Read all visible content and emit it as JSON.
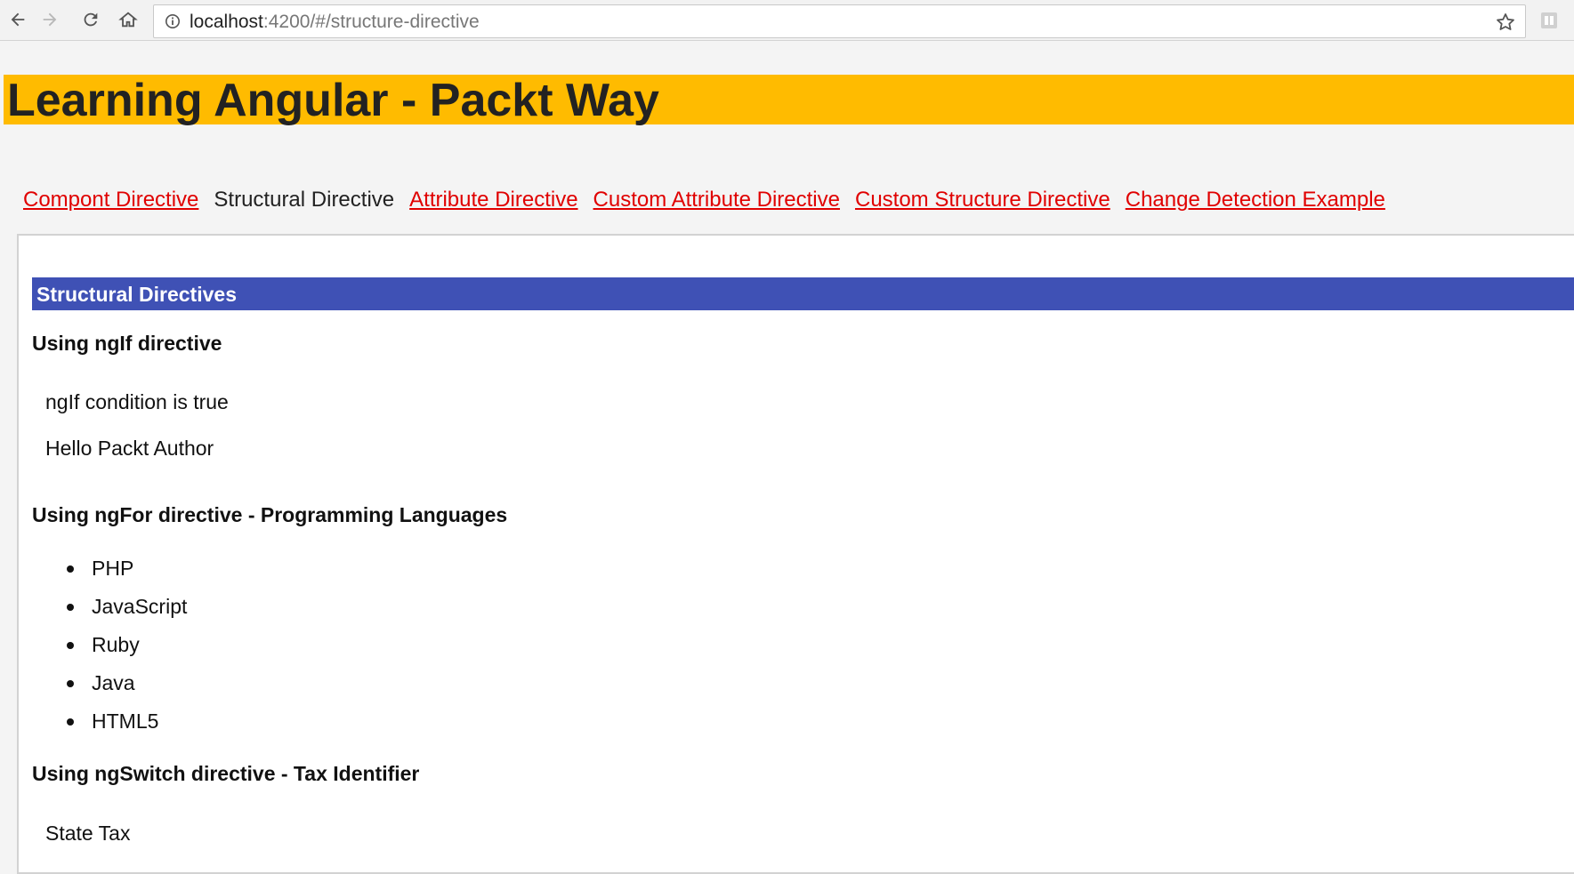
{
  "browser": {
    "url_host": "localhost",
    "url_path": ":4200/#/structure-directive",
    "icons": [
      "back-icon",
      "forward-icon",
      "reload-icon",
      "home-icon",
      "info-icon",
      "star-icon",
      "extension-icon"
    ]
  },
  "app": {
    "title": "Learning Angular - Packt Way",
    "header_color": "#ffbb00"
  },
  "nav": {
    "items": [
      {
        "label": "Compont Directive",
        "active": false
      },
      {
        "label": "Structural Directive",
        "active": true
      },
      {
        "label": "Attribute Directive",
        "active": false
      },
      {
        "label": "Custom Attribute Directive",
        "active": false
      },
      {
        "label": "Custom Structure Directive",
        "active": false
      },
      {
        "label": "Change Detection Example",
        "active": false
      }
    ],
    "link_color": "#e00000"
  },
  "content": {
    "section_title": "Structural Directives",
    "section_color": "#3f51b5",
    "ngif": {
      "heading": "Using ngIf directive",
      "condition_text": "ngIf condition is true",
      "greeting": "Hello Packt Author"
    },
    "ngfor": {
      "heading": "Using ngFor directive - Programming Languages",
      "languages": [
        "PHP",
        "JavaScript",
        "Ruby",
        "Java",
        "HTML5"
      ]
    },
    "ngswitch": {
      "heading": "Using ngSwitch directive - Tax Identifier",
      "result": "State Tax"
    }
  }
}
